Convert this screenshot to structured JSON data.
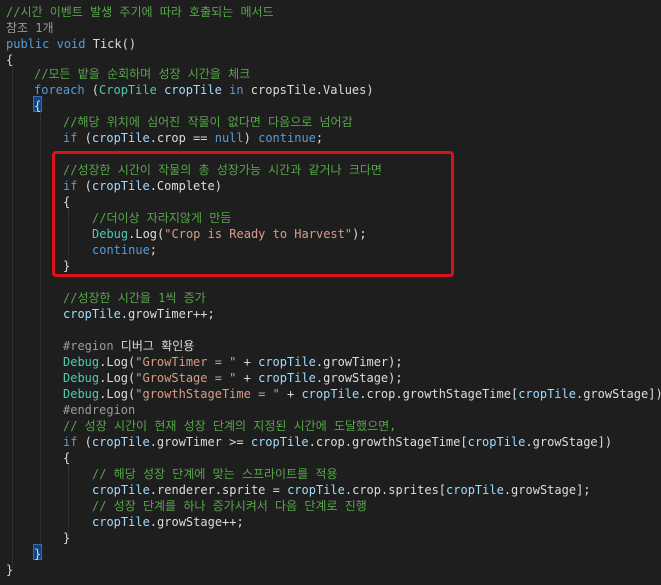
{
  "code": {
    "l1": [
      [
        "cm",
        "//시간 이벤트 발생 주기에 따라 호출되는 메서드"
      ]
    ],
    "l2": [
      [
        "ref",
        "참조 1개"
      ]
    ],
    "l3": [
      [
        "kw",
        "public"
      ],
      [
        "pl",
        " "
      ],
      [
        "kw",
        "void"
      ],
      [
        "pl",
        " Tick()"
      ]
    ],
    "l4": [
      [
        "pl",
        "{"
      ]
    ],
    "l5": [
      [
        "cm",
        "//모든 밭을 순회하며 성장 시간을 체크"
      ]
    ],
    "l6": [
      [
        "kw",
        "foreach"
      ],
      [
        "pl",
        " ("
      ],
      [
        "ty",
        "CropTile"
      ],
      [
        "pl",
        " "
      ],
      [
        "id",
        "cropTile"
      ],
      [
        "pl",
        " "
      ],
      [
        "kw",
        "in"
      ],
      [
        "pl",
        " cropsTile.Values)"
      ]
    ],
    "l7": [
      [
        "pl",
        "{"
      ]
    ],
    "l8": [
      [
        "cm",
        "//해당 위치에 심어진 작물이 없다면 다음으로 넘어감"
      ]
    ],
    "l9": [
      [
        "kw",
        "if"
      ],
      [
        "pl",
        " ("
      ],
      [
        "id",
        "cropTile"
      ],
      [
        "pl",
        ".crop == "
      ],
      [
        "kw",
        "null"
      ],
      [
        "pl",
        ") "
      ],
      [
        "kw",
        "continue"
      ],
      [
        "pl",
        ";"
      ]
    ],
    "l10": [
      [
        "cm",
        "//성장한 시간이 작물의 총 성장가능 시간과 같거나 크다면"
      ]
    ],
    "l11": [
      [
        "kw",
        "if"
      ],
      [
        "pl",
        " ("
      ],
      [
        "id",
        "cropTile"
      ],
      [
        "pl",
        ".Complete)"
      ]
    ],
    "l12": [
      [
        "pl",
        "{"
      ]
    ],
    "l13": [
      [
        "cm",
        "//더이상 자라지않게 만듬"
      ]
    ],
    "l14": [
      [
        "ty",
        "Debug"
      ],
      [
        "pl",
        "."
      ],
      [
        "pl",
        "Log("
      ],
      [
        "st",
        "\"Crop is Ready to Harvest\""
      ],
      [
        "pl",
        ");"
      ]
    ],
    "l15": [
      [
        "kw",
        "continue"
      ],
      [
        "pl",
        ";"
      ]
    ],
    "l16": [
      [
        "pl",
        "}"
      ]
    ],
    "l17": [
      [
        "cm",
        "//성장한 시간을 1씩 증가"
      ]
    ],
    "l18": [
      [
        "id",
        "cropTile"
      ],
      [
        "pl",
        ".growTimer++;"
      ]
    ],
    "l19": [
      [
        "pp",
        "#region"
      ],
      [
        "rg",
        " 디버그 확인용"
      ]
    ],
    "l20": [
      [
        "ty",
        "Debug"
      ],
      [
        "pl",
        ".Log("
      ],
      [
        "st",
        "\"GrowTimer = \""
      ],
      [
        "pl",
        " + "
      ],
      [
        "id",
        "cropTile"
      ],
      [
        "pl",
        ".growTimer);"
      ]
    ],
    "l21": [
      [
        "ty",
        "Debug"
      ],
      [
        "pl",
        ".Log("
      ],
      [
        "st",
        "\"GrowStage = \""
      ],
      [
        "pl",
        " + "
      ],
      [
        "id",
        "cropTile"
      ],
      [
        "pl",
        ".growStage);"
      ]
    ],
    "l22": [
      [
        "ty",
        "Debug"
      ],
      [
        "pl",
        ".Log("
      ],
      [
        "st",
        "\"growthStageTime = \""
      ],
      [
        "pl",
        " + "
      ],
      [
        "id",
        "cropTile"
      ],
      [
        "pl",
        ".crop.growthStageTime["
      ],
      [
        "id",
        "cropTile"
      ],
      [
        "pl",
        ".growStage]);"
      ]
    ],
    "l23": [
      [
        "pp",
        "#endregion"
      ]
    ],
    "l24": [
      [
        "cm",
        "// 성장 시간이 현재 성장 단계의 지정된 시간에 도달했으면,"
      ]
    ],
    "l25": [
      [
        "kw",
        "if"
      ],
      [
        "pl",
        " ("
      ],
      [
        "id",
        "cropTile"
      ],
      [
        "pl",
        ".growTimer >= "
      ],
      [
        "id",
        "cropTile"
      ],
      [
        "pl",
        ".crop.growthStageTime["
      ],
      [
        "id",
        "cropTile"
      ],
      [
        "pl",
        ".growStage])"
      ]
    ],
    "l26": [
      [
        "pl",
        "{"
      ]
    ],
    "l27": [
      [
        "cm",
        "// 해당 성장 단계에 맞는 스프라이트를 적용"
      ]
    ],
    "l28": [
      [
        "id",
        "cropTile"
      ],
      [
        "pl",
        ".renderer.sprite = "
      ],
      [
        "id",
        "cropTile"
      ],
      [
        "pl",
        ".crop.sprites["
      ],
      [
        "id",
        "cropTile"
      ],
      [
        "pl",
        ".growStage];"
      ]
    ],
    "l29": [
      [
        "cm",
        "// 성장 단계를 하나 증가시켜서 다음 단계로 진행"
      ]
    ],
    "l30": [
      [
        "id",
        "cropTile"
      ],
      [
        "pl",
        ".growStage++;"
      ]
    ],
    "l31": [
      [
        "pl",
        "}"
      ]
    ],
    "l32": [
      [
        "pl",
        "}"
      ]
    ],
    "l33": [
      [
        "pl",
        "}"
      ]
    ]
  },
  "colors": {
    "background": "#1e1e1e",
    "comment": "#57a64a",
    "keyword": "#569cd6",
    "type": "#4ec9b0",
    "identifier": "#9cdcfe",
    "string": "#d69d85",
    "highlight_box": "#d8141a"
  }
}
